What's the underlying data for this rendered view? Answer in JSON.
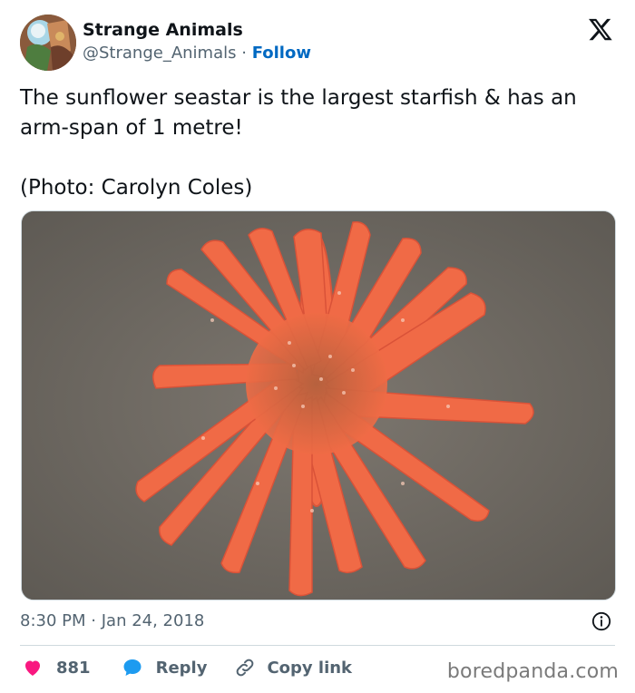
{
  "account": {
    "display_name": "Strange Animals",
    "handle": "@Strange_Animals",
    "separator": "·",
    "follow_label": "Follow"
  },
  "tweet": {
    "text_line1": "The sunflower seastar is the largest starfish & has an arm-span of 1 metre!",
    "text_line2": "(Photo: Carolyn Coles)",
    "time": "8:30 PM",
    "date_separator": "·",
    "date": "Jan 24, 2018"
  },
  "actions": {
    "like_count": "881",
    "reply_label": "Reply",
    "copy_link_label": "Copy link"
  },
  "watermark": "boredpanda.com",
  "icons": {
    "logo": "x-logo-icon",
    "info": "info-icon",
    "like": "heart-icon",
    "reply": "speech-bubble-icon",
    "copy": "link-icon"
  },
  "colors": {
    "follow": "#0069c2",
    "heart": "#f91880",
    "reply": "#1d9bf0",
    "muted": "#536471"
  }
}
